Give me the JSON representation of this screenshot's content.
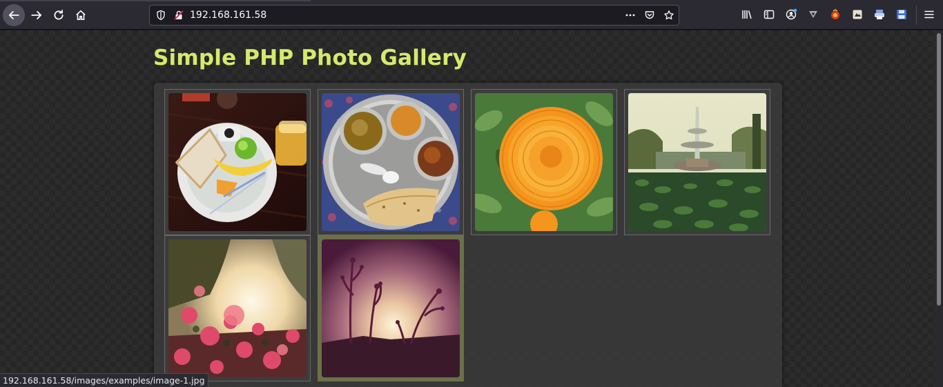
{
  "browser": {
    "url": "192.168.161.58",
    "toolbar_icons": [
      "library-icon",
      "sidebar-icon",
      "account-icon",
      "vpn-extension-icon",
      "extension-icon",
      "extension-icon-2",
      "extension-icon-3",
      "save-icon",
      "menu-icon"
    ]
  },
  "page": {
    "title": "Simple PHP Photo Gallery",
    "accent_color": "#d4ea6e",
    "thumbnails": [
      {
        "alt": "breakfast-photo",
        "link": "192.168.161.58/images/examples/image-1.jpg"
      },
      {
        "alt": "thali-photo"
      },
      {
        "alt": "marigold-photo"
      },
      {
        "alt": "fountain-photo"
      },
      {
        "alt": "bougainvillea-photo"
      },
      {
        "alt": "sunset-plants-photo"
      }
    ]
  },
  "status_bar": {
    "text": "192.168.161.58/images/examples/image-1.jpg"
  }
}
